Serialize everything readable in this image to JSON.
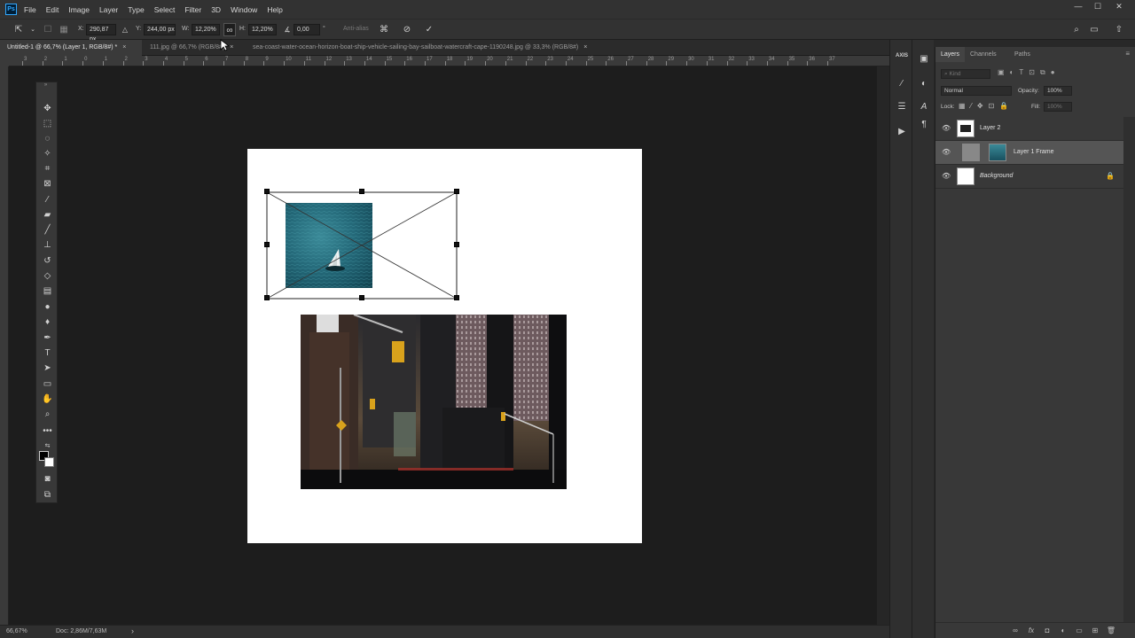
{
  "app": {
    "logo": "Ps",
    "menus": [
      "File",
      "Edit",
      "Image",
      "Layer",
      "Type",
      "Select",
      "Filter",
      "3D",
      "Window",
      "Help"
    ]
  },
  "options_bar": {
    "x_label": "X:",
    "x_value": "290,87 px",
    "y_label": "Y:",
    "y_value": "244,00 px",
    "w_label": "W:",
    "w_value": "12,20%",
    "h_label": "H:",
    "h_value": "12,20%",
    "angle_value": "0,00",
    "degree_symbol": "°",
    "antialias_label": "Anti-alias"
  },
  "tabs": [
    {
      "label": "Untitled-1 @ 66,7% (Layer 1, RGB/8#) *",
      "active": true
    },
    {
      "label": "111.jpg @ 66,7% (RGB/8#)",
      "active": false
    },
    {
      "label": "sea-coast-water-ocean-horizon-boat-ship-vehicle-sailing-bay-sailboat-watercraft-cape-1190248.jpg @ 33,3% (RGB/8#)",
      "active": false
    }
  ],
  "ruler_h_ticks": [
    "3",
    "2",
    "1",
    "0",
    "1",
    "2",
    "3",
    "4",
    "5",
    "6",
    "7",
    "8",
    "9",
    "10",
    "11",
    "12",
    "13",
    "14",
    "15",
    "16",
    "17",
    "18",
    "19",
    "20",
    "21",
    "22",
    "23",
    "24",
    "25",
    "26",
    "27",
    "28",
    "29",
    "30",
    "31",
    "32",
    "33",
    "34",
    "35",
    "36",
    "37"
  ],
  "status": {
    "zoom": "66,67%",
    "doc": "Doc: 2,86M/7,63M",
    "arrow": "›"
  },
  "panel_tabs": [
    "Layers",
    "Channels",
    "Paths"
  ],
  "layers_panel": {
    "kind_placeholder": "Kind",
    "blend_mode": "Normal",
    "opacity_label": "Opacity:",
    "opacity_value": "100%",
    "lock_label": "Lock:",
    "fill_label": "Fill:",
    "fill_value": "100%",
    "layers": [
      {
        "name": "Layer 2",
        "selected": false,
        "italic": false
      },
      {
        "name": "Layer 1 Frame",
        "selected": true,
        "italic": false
      },
      {
        "name": "Background",
        "selected": false,
        "italic": true
      }
    ]
  },
  "side_icons": {
    "axis_label": "AXIS"
  },
  "colors": {
    "accent": "#31a8ff",
    "panel_bg": "#383838",
    "pasteboard": "#1d1d1d",
    "selected_row": "#555555"
  }
}
